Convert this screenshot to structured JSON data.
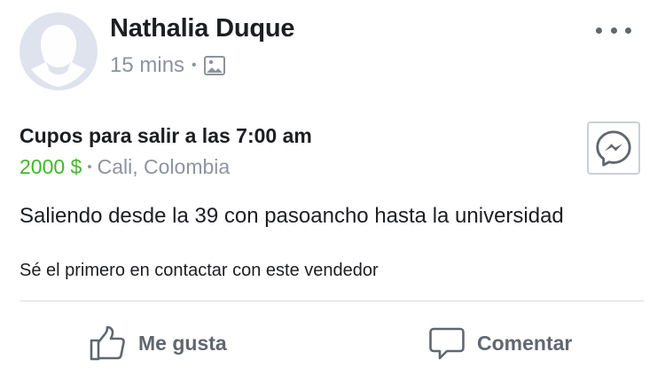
{
  "post": {
    "author": "Nathalia Duque",
    "time": "15 mins",
    "meta_separator": "•",
    "privacy_icon": "photo-icon"
  },
  "listing": {
    "title": "Cupos para salir a las 7:00 am",
    "price": "2000 $",
    "separator": "•",
    "location": "Cali, Colombia",
    "description": "Saliendo desde la 39 con pasoancho hasta la universidad",
    "contact_note": "Sé el primero en contactar con este vendedor"
  },
  "actions": {
    "like_label": "Me gusta",
    "comment_label": "Comentar"
  },
  "colors": {
    "price": "#42b72a",
    "muted": "#8d949e",
    "action": "#606770"
  }
}
